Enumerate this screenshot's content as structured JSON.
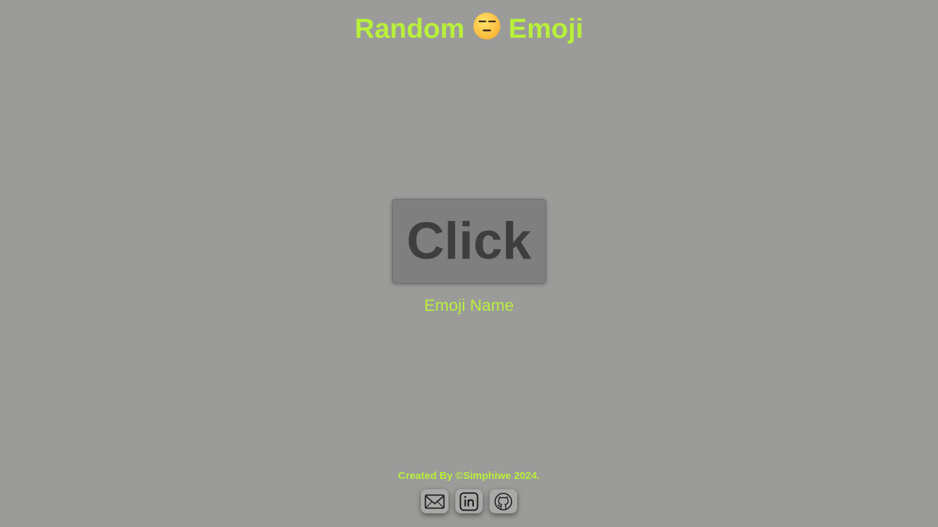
{
  "header": {
    "title_left": "Random",
    "title_right": "Emoji",
    "emoji_icon": "expressionless-face-icon"
  },
  "main": {
    "button_label": "Click",
    "emoji_name": "Emoji Name"
  },
  "footer": {
    "credit": "Created By ©Simphiwe 2024.",
    "links": [
      {
        "icon": "mail-icon"
      },
      {
        "icon": "linkedin-icon"
      },
      {
        "icon": "github-icon"
      }
    ]
  },
  "colors": {
    "background": "#9b9b99",
    "accent": "#b8f03a",
    "button": "#7f7f7f",
    "button_text": "#3e3e3e"
  }
}
